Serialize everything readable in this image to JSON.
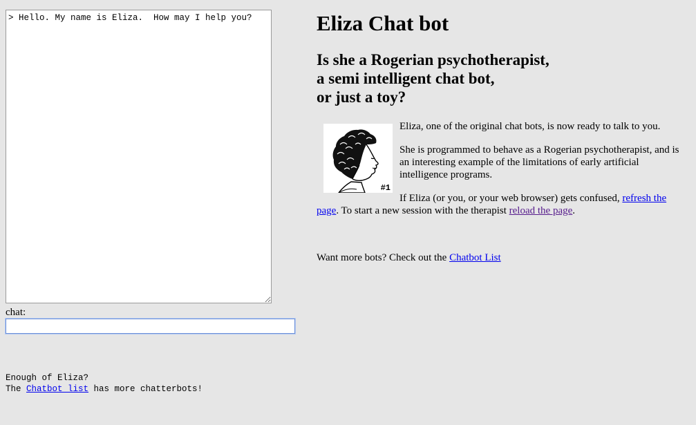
{
  "left": {
    "transcript": "> Hello. My name is Eliza.  How may I help you?",
    "chat_label": "chat:",
    "chat_value": "",
    "footer_line1": "Enough of Eliza?",
    "footer_line2_prefix": "The ",
    "footer_link": "Chatbot list",
    "footer_line2_suffix": " has more chatterbots!"
  },
  "right": {
    "title": "Eliza Chat bot",
    "subtitle_lines": [
      "Is she a Rogerian psychotherapist,",
      "a semi intelligent chat bot,",
      "or just a toy?"
    ],
    "image_badge": "#1",
    "para1": "Eliza, one of the original chat bots, is now ready to talk to you.",
    "para2": "She is programmed to behave as a Rogerian psychotherapist, and is an interesting example of the limitations of early artificial intelligence programs.",
    "para3_start": "If Eliza (or you, or your web browser) gets confused, ",
    "para3_link1": "refresh the page",
    "para3_mid": ". To start a new session with the therapist ",
    "para3_link2": "reload the page",
    "para3_end": ".",
    "para4_start": "Want more bots? Check out the ",
    "para4_link": "Chatbot List"
  },
  "colors": {
    "background": "#e6e6e6",
    "link": "#0000ee",
    "visited_link": "#551a8b",
    "input_focus_border": "#6b8fd6"
  },
  "icons": {
    "portrait": "eliza-portrait-sketch"
  }
}
